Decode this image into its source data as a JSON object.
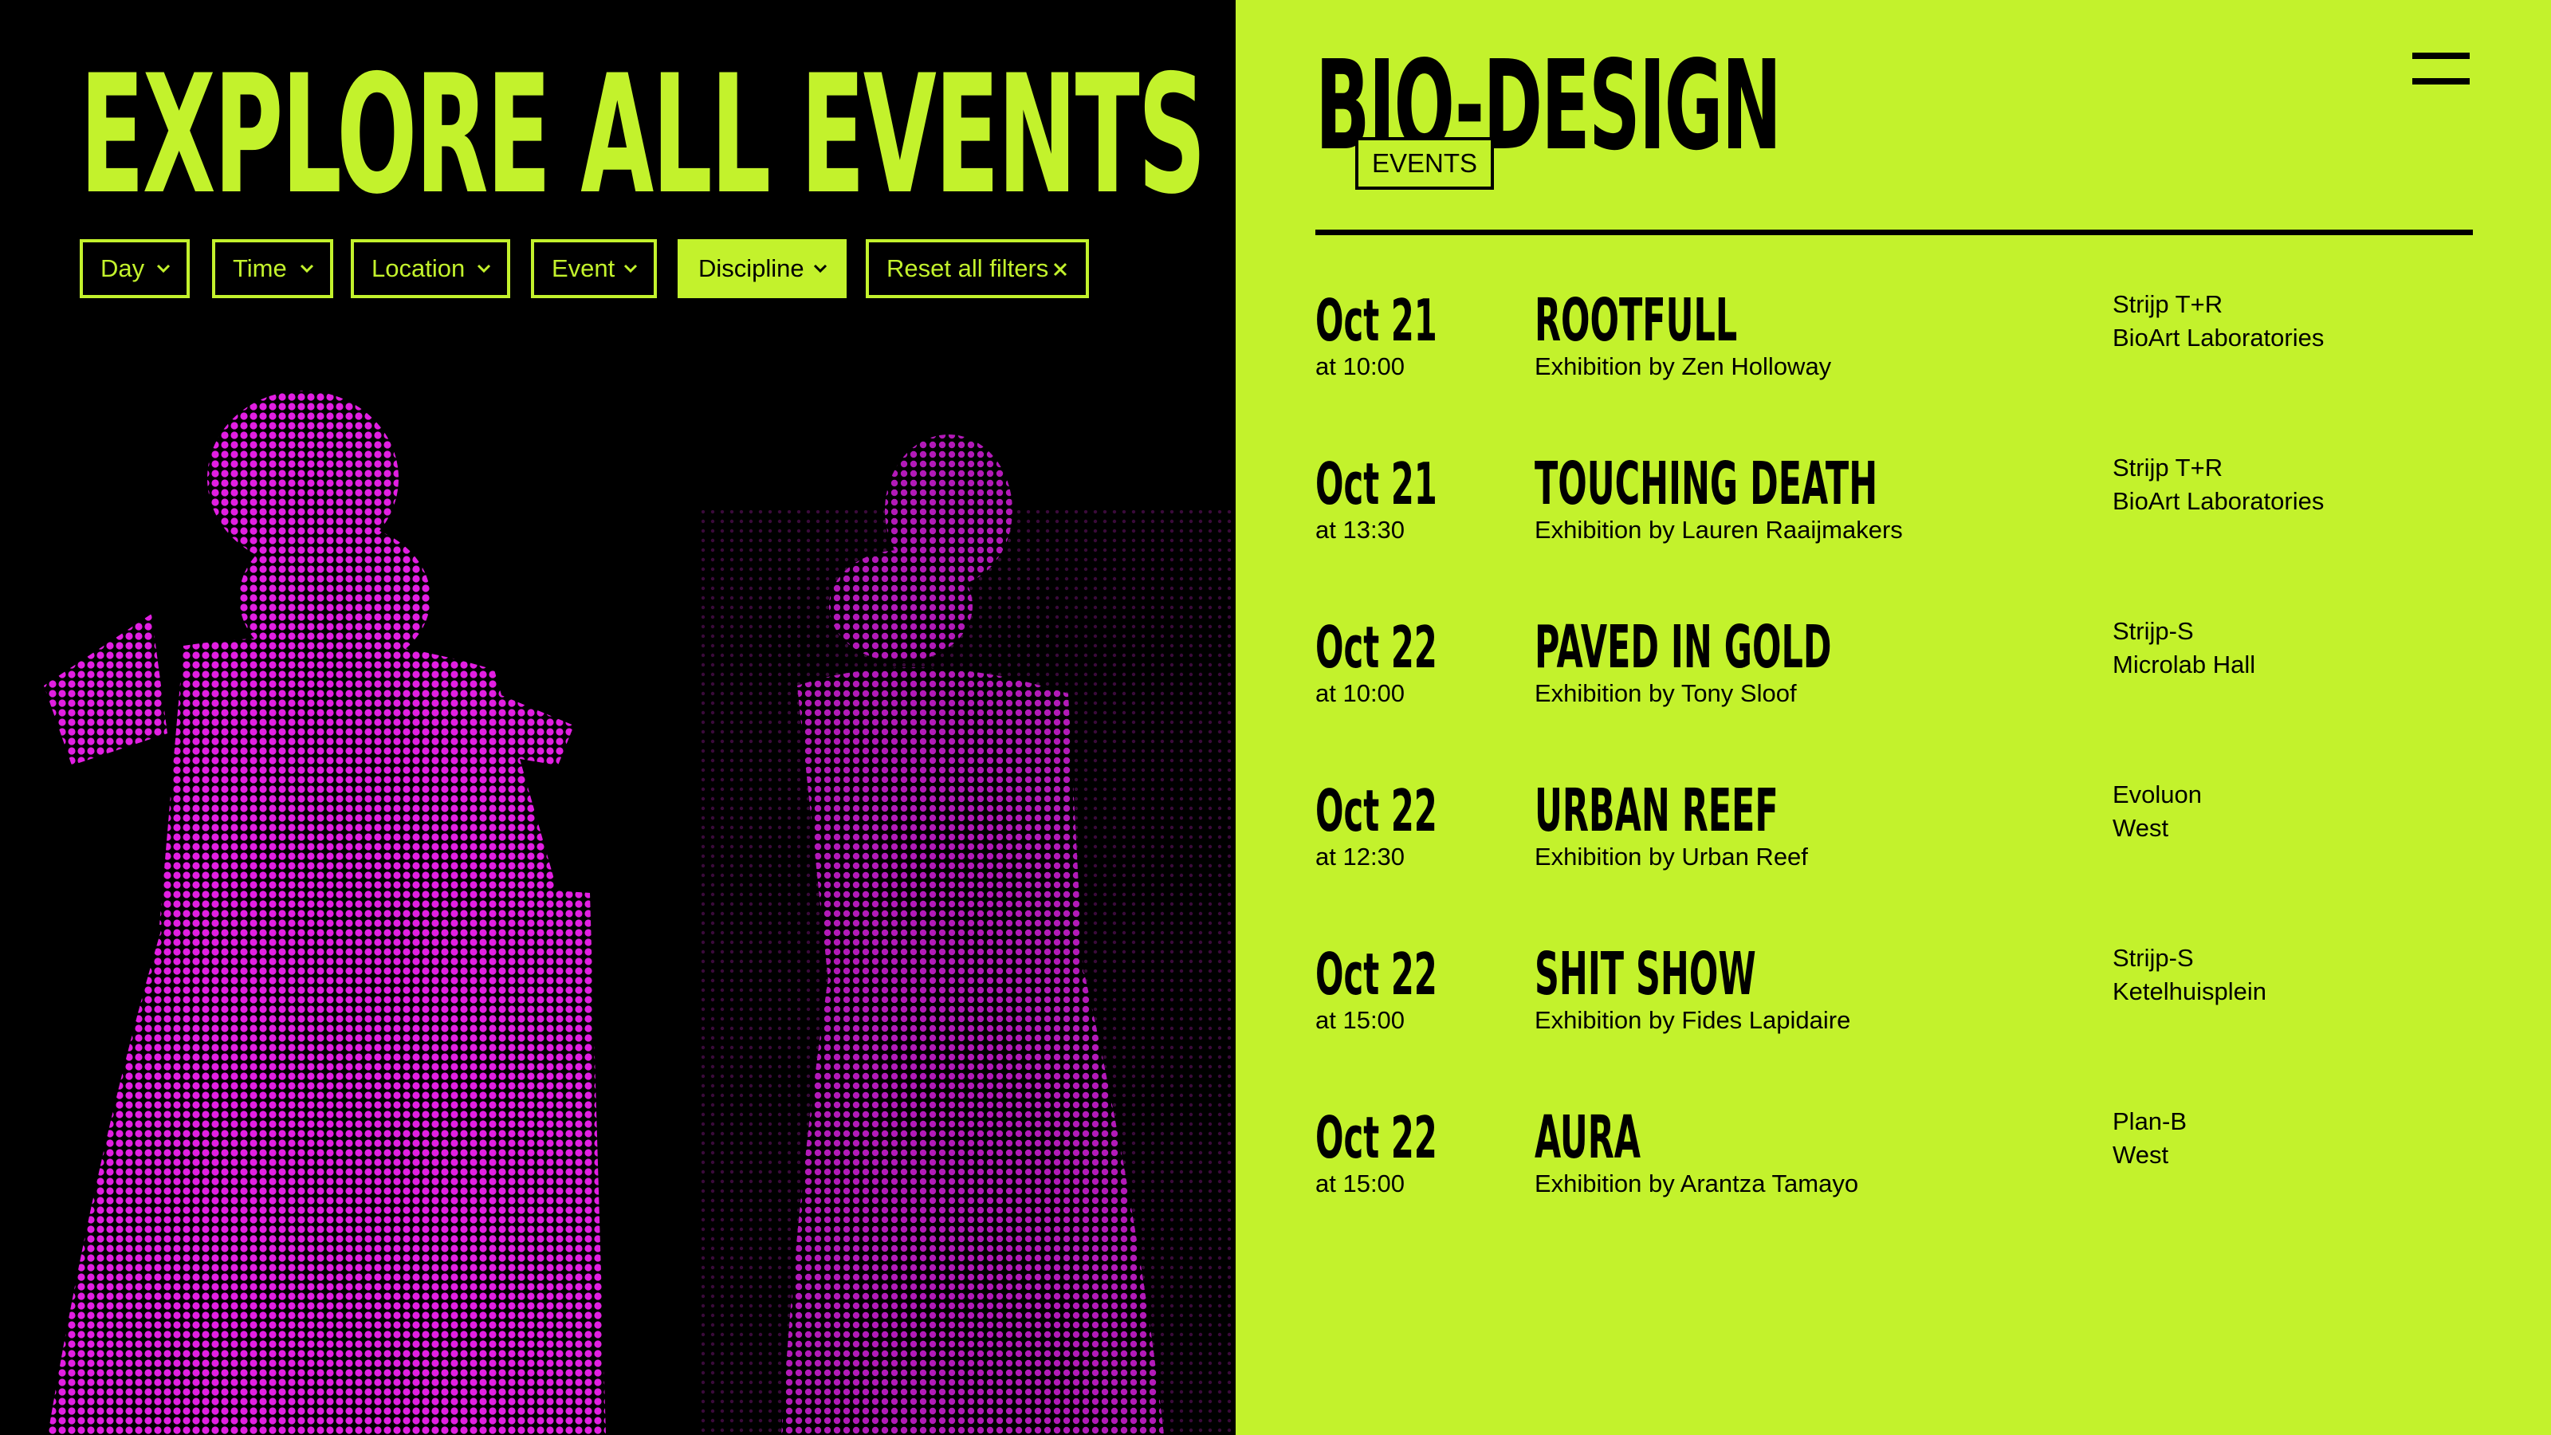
{
  "left": {
    "headline": "EXPLORE ALL EVENTS",
    "filters": [
      {
        "label": "Day",
        "icon": "chevron-down-icon",
        "active": false
      },
      {
        "label": "Time",
        "icon": "chevron-down-icon",
        "active": false
      },
      {
        "label": "Location",
        "icon": "chevron-down-icon",
        "active": false
      },
      {
        "label": "Event",
        "icon": "chevron-down-icon",
        "active": false
      },
      {
        "label": "Discipline",
        "icon": "chevron-down-icon",
        "active": true
      },
      {
        "label": "Reset all filters",
        "icon": "close-icon",
        "active": false
      }
    ]
  },
  "right": {
    "brand": "BIO-DESIGN",
    "brand_tag": "EVENTS",
    "menu_icon": "hamburger-menu-icon",
    "events": [
      {
        "date": "Oct 21",
        "time": "at 10:00",
        "title": "ROOTFULL",
        "subtitle": "Exhibition by Zen Holloway",
        "location": "Strijp T+R",
        "venue": "BioArt Laboratories"
      },
      {
        "date": "Oct 21",
        "time": "at 13:30",
        "title": "TOUCHING DEATH",
        "subtitle": "Exhibition by Lauren Raaijmakers",
        "location": "Strijp T+R",
        "venue": "BioArt Laboratories"
      },
      {
        "date": "Oct 22",
        "time": "at 10:00",
        "title": "PAVED IN GOLD",
        "subtitle": "Exhibition by Tony Sloof",
        "location": "Strijp-S",
        "venue": "Microlab Hall"
      },
      {
        "date": "Oct 22",
        "time": "at 12:30",
        "title": "URBAN REEF",
        "subtitle": "Exhibition by Urban Reef",
        "location": "Evoluon",
        "venue": "West"
      },
      {
        "date": "Oct 22",
        "time": "at 15:00",
        "title": "SHIT SHOW",
        "subtitle": "Exhibition by Fides Lapidaire",
        "location": "Strijp-S",
        "venue": "Ketelhuisplein"
      },
      {
        "date": "Oct 22",
        "time": "at 15:00",
        "title": "AURA",
        "subtitle": "Exhibition by Arantza Tamayo",
        "location": "Plan-B",
        "venue": "West"
      }
    ]
  },
  "colors": {
    "accent": "#c3f22c",
    "background": "#000000",
    "photo_tint": "#e020e0"
  }
}
